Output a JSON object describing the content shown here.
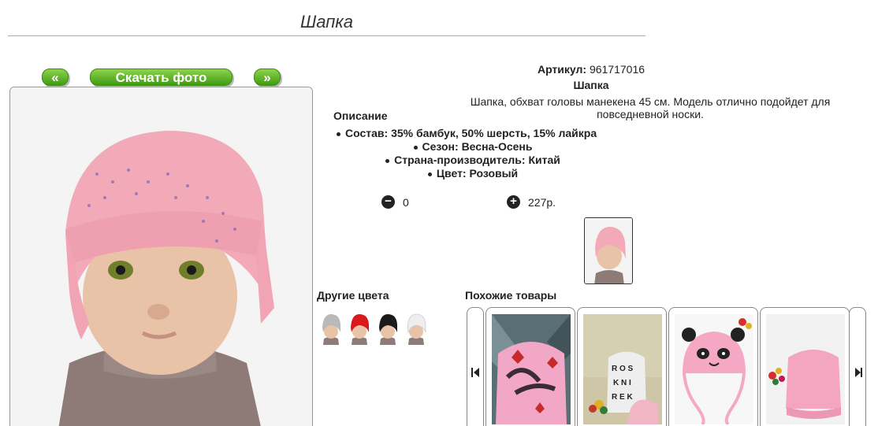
{
  "page": {
    "title": "Шапка"
  },
  "gallery": {
    "prev_label": "«",
    "download_label": "Скачать фото",
    "next_label": "»"
  },
  "product": {
    "sku_label": "Артикул:",
    "sku_value": "961717016",
    "name": "Шапка",
    "description": "Шапка, обхват головы манекена 45 см. Модель отлично подойдет для повседневной носки.",
    "description_heading": "Описание",
    "properties": [
      "Состав: 35% бамбук, 50% шерсть, 15% лайкра",
      "Сезон: Весна-Осень",
      "Страна-производитель: Китай",
      "Цвет: Розовый"
    ],
    "quantity": "0",
    "minus_icon": "−",
    "plus_icon": "+",
    "price": "227р."
  },
  "other_colors": {
    "title": "Другие цвета",
    "swatches": [
      {
        "color": "#b9b9b9"
      },
      {
        "color": "#d91a1a"
      },
      {
        "color": "#1a1a1a"
      },
      {
        "color": "#eeeeee"
      }
    ]
  },
  "similar": {
    "title": "Похожие товары"
  },
  "colors": {
    "accent": "#4caf1f",
    "hat_pink": "#f2a9b8"
  }
}
